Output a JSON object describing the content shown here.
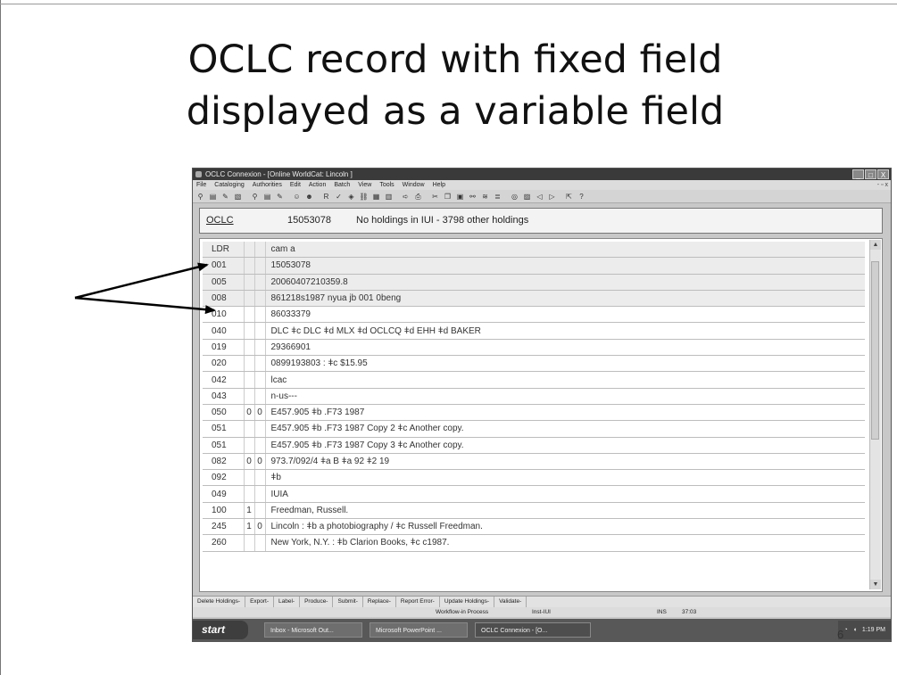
{
  "slide": {
    "title_line1": "OCLC record with fixed field",
    "title_line2": "displayed as a variable field",
    "page_number": "6"
  },
  "window": {
    "title": "OCLC Connexion - [Online WorldCat: Lincoln ]",
    "buttons": [
      "_",
      "□",
      "X"
    ],
    "mdi_controls": "- ▫ x"
  },
  "menu": [
    "File",
    "Cataloging",
    "Authorities",
    "Edit",
    "Action",
    "Batch",
    "View",
    "Tools",
    "Window",
    "Help"
  ],
  "header": {
    "link": "OCLC",
    "ocn": "15053078",
    "holdings": "No holdings in IUI - 3798 other holdings"
  },
  "record": [
    {
      "tag": "LDR",
      "i1": "",
      "i2": "",
      "field": "cam  a",
      "fixed": true
    },
    {
      "tag": "001",
      "i1": "",
      "i2": "",
      "field": "15053078",
      "fixed": true
    },
    {
      "tag": "005",
      "i1": "",
      "i2": "",
      "field": "20060407210359.8",
      "fixed": true
    },
    {
      "tag": "008",
      "i1": "",
      "i2": "",
      "field": "861218s1987    nyua    jb    001 0beng",
      "fixed": true
    },
    {
      "tag": "010",
      "i1": "",
      "i2": "",
      "field": "  86033379",
      "fixed": false
    },
    {
      "tag": "040",
      "i1": "",
      "i2": "",
      "field": "DLC ǂc DLC ǂd MLX ǂd OCLCQ ǂd EHH ǂd BAKER",
      "fixed": false
    },
    {
      "tag": "019",
      "i1": "",
      "i2": "",
      "field": "29366901",
      "fixed": false
    },
    {
      "tag": "020",
      "i1": "",
      "i2": "",
      "field": "0899193803 : ǂc $15.95",
      "fixed": false
    },
    {
      "tag": "042",
      "i1": "",
      "i2": "",
      "field": "lcac",
      "fixed": false
    },
    {
      "tag": "043",
      "i1": "",
      "i2": "",
      "field": "n-us---",
      "fixed": false
    },
    {
      "tag": "050",
      "i1": "0",
      "i2": "0",
      "field": "E457.905 ǂb .F73 1987",
      "fixed": false
    },
    {
      "tag": "051",
      "i1": "",
      "i2": "",
      "field": "E457.905 ǂb .F73 1987 Copy 2 ǂc Another copy.",
      "fixed": false
    },
    {
      "tag": "051",
      "i1": "",
      "i2": "",
      "field": "E457.905 ǂb .F73 1987 Copy 3 ǂc Another copy.",
      "fixed": false
    },
    {
      "tag": "082",
      "i1": "0",
      "i2": "0",
      "field": "973.7/092/4 ǂa B ǂa 92 ǂ2 19",
      "fixed": false
    },
    {
      "tag": "092",
      "i1": "",
      "i2": "",
      "field": "ǂb",
      "fixed": false
    },
    {
      "tag": "049",
      "i1": "",
      "i2": "",
      "field": "IUIA",
      "fixed": false
    },
    {
      "tag": "100",
      "i1": "1",
      "i2": "",
      "field": "Freedman, Russell.",
      "fixed": false
    },
    {
      "tag": "245",
      "i1": "1",
      "i2": "0",
      "field": "Lincoln : ǂb a photobiography / ǂc Russell Freedman.",
      "fixed": false
    },
    {
      "tag": "260",
      "i1": "",
      "i2": "",
      "field": "New York, N.Y. : ǂb Clarion Books, ǂc c1987.",
      "fixed": false
    }
  ],
  "function_keys": [
    "Delete Holdings-",
    "Export-",
    "Label-",
    "Produce-",
    "Submit-",
    "Replace-",
    "Report Error-",
    "Update Holdings-",
    "Validate-"
  ],
  "status": {
    "workflow": "Workflow-in Process",
    "inst": "Inst-IUI",
    "mode": "INS",
    "pos": "37:03"
  },
  "taskbar": {
    "start": "start",
    "tasks": [
      "Inbox - Microsoft Out...",
      "Microsoft PowerPoint ...",
      "OCLC Connexion - [O..."
    ],
    "clock": "1:19 PM"
  },
  "colors": {
    "arrow": "#000000",
    "fixed_row": "#ececec",
    "taskbar": "#585858"
  }
}
